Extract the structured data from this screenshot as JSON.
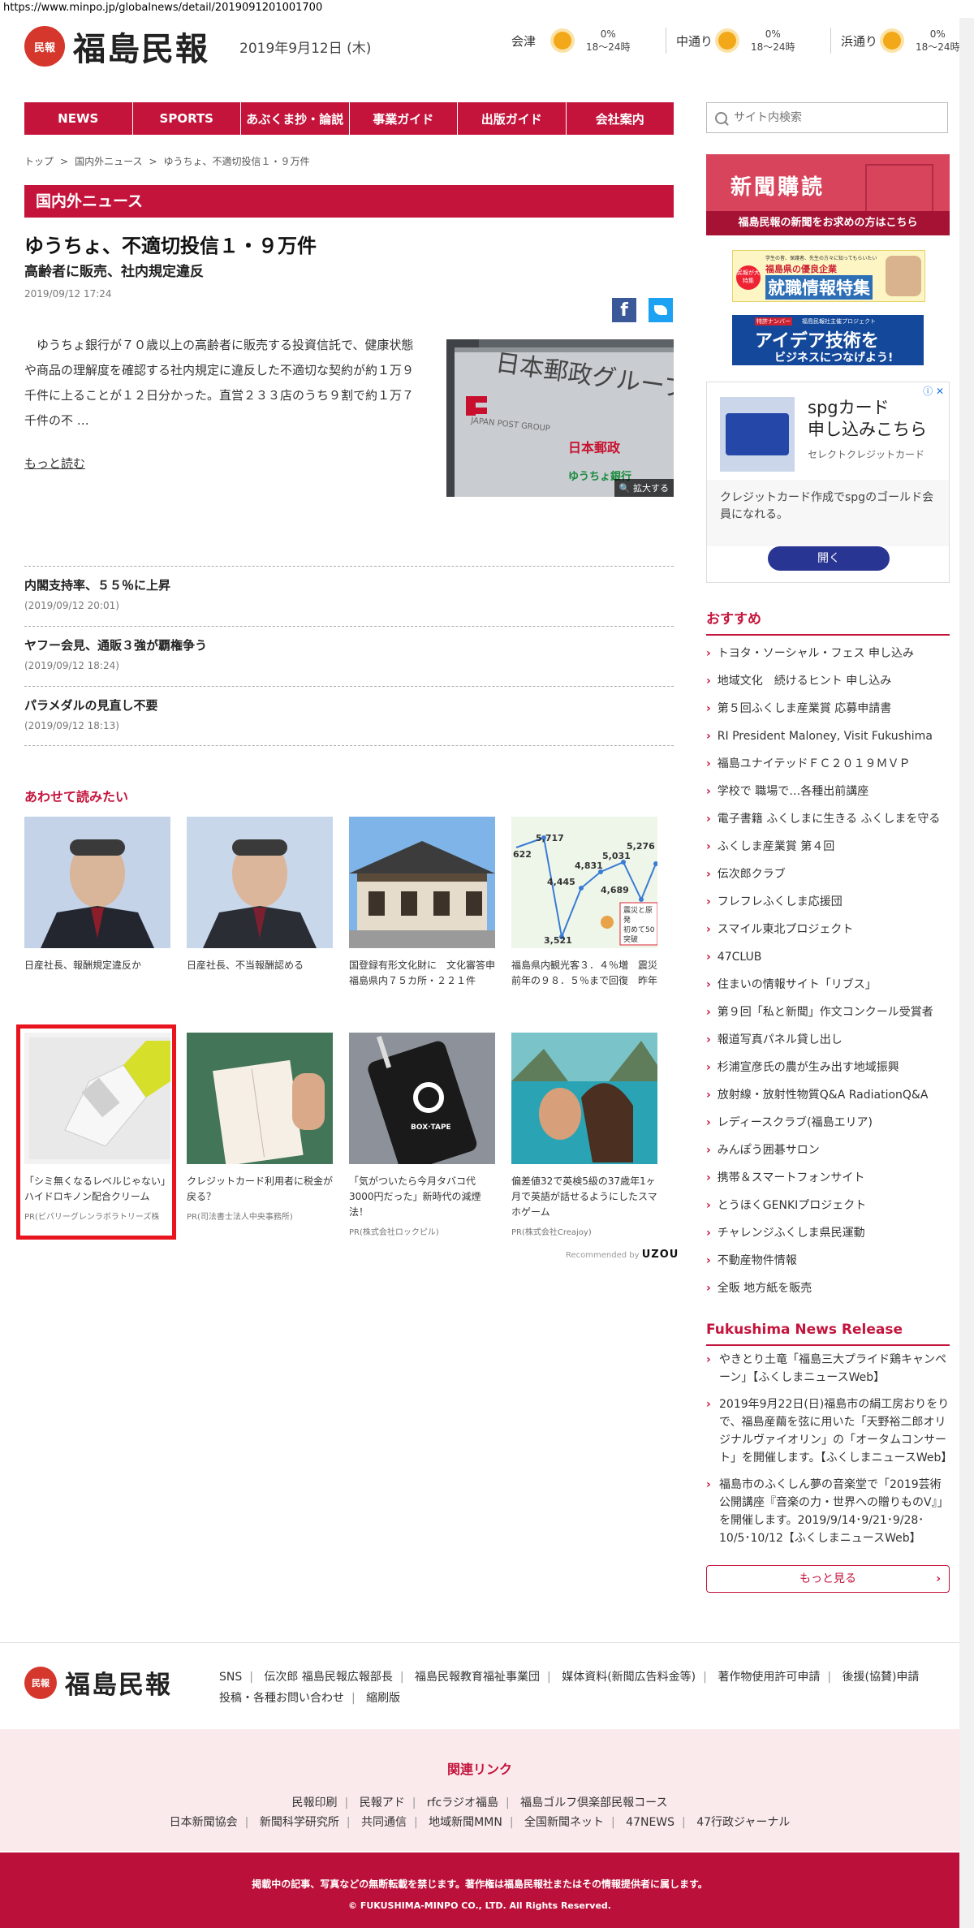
{
  "url": "https://www.minpo.jp/globalnews/detail/2019091201001700",
  "header": {
    "logo_mark": "民報",
    "logo_text": "福島民報",
    "date": "2019年9月12日 (木)",
    "weather": [
      {
        "area": "会津",
        "pct": "0%",
        "time": "18〜24時"
      },
      {
        "area": "中通り",
        "pct": "0%",
        "time": "18〜24時"
      },
      {
        "area": "浜通り",
        "pct": "0%",
        "time": "18〜24時"
      }
    ]
  },
  "nav": [
    "NEWS",
    "SPORTS",
    "あぶくま抄・論説",
    "事業ガイド",
    "出版ガイド",
    "会社案内"
  ],
  "search": {
    "placeholder": "サイト内検索"
  },
  "breadcrumb": [
    "トップ",
    ">",
    "国内外ニュース",
    ">",
    "ゆうちょ、不適切投信１・９万件"
  ],
  "section_title": "国内外ニュース",
  "article": {
    "title": "ゆうちょ、不適切投信１・９万件",
    "subtitle": "高齢者に販売、社内規定違反",
    "date": "2019/09/12 17:24",
    "body": "ゆうちょ銀行が７０歳以上の高齢者に販売する投資信託で、健康状態や商品の理解度を確認する社内規定に違反した不適切な契約が約１万９千件に上ることが１２日分かった。直営２３３店のうち９割で約１万７千件の不 …",
    "more": "もっと読む",
    "photo_text": "日本郵政グループ",
    "photo_sub": "JAPAN POST GROUP",
    "photo_sign1": "日本郵政",
    "photo_sign2": "ゆうちょ銀行",
    "zoom": "拡大する"
  },
  "related_list": [
    {
      "title": "内閣支持率、５５％に上昇",
      "date": "(2019/09/12 20:01)"
    },
    {
      "title": "ヤフー会見、通販３強が覇権争う",
      "date": "(2019/09/12 18:24)"
    },
    {
      "title": "パラメダルの見直し不要",
      "date": "(2019/09/12 18:13)"
    }
  ],
  "recommend": {
    "heading": "あわせて読みたい",
    "cards": [
      {
        "caption": "日産社長、報酬規定違反か",
        "pr": ""
      },
      {
        "caption": "日産社長、不当報酬認める",
        "pr": ""
      },
      {
        "caption": "国登録有形文化財に　文化審答申　福島県内７５カ所・２２１件",
        "pr": ""
      },
      {
        "caption": "福島県内観光客３．４％増　震災前年の９８．５％まで回復　昨年",
        "pr": ""
      },
      {
        "caption": "「シミ無くなるレベルじゃない」ハイドロキノン配合クリーム",
        "pr": "PR(ビバリーグレンラボラトリーズ株"
      },
      {
        "caption": "クレジットカード利用者に税金が戻る？",
        "pr": "PR(司法書士法人中央事務所)"
      },
      {
        "caption": "「気がついたら今月タバコ代3000円だった」新時代の減煙法！",
        "pr": "PR(株式会社ロックピル)"
      },
      {
        "caption": "偏差値32で英検5級の37歳年1ヶ月で英語が話せるようにしたスマホゲーム",
        "pr": "PR(株式会社Creajoy)"
      }
    ],
    "chart_labels": [
      "622",
      "5,717",
      "3,521",
      "4,445",
      "4,831",
      "5,031",
      "4,689",
      "5,276"
    ],
    "chart_note": [
      "震災と原発",
      "初めて50",
      "突破"
    ],
    "box_label": "BOX·TAPE",
    "recommended_by": "Recommended by",
    "recommended_brand": "UZOU"
  },
  "sidebar": {
    "subscribe_title": "新聞購読",
    "subscribe_bar": "福島民報の新聞をお求めの方はこちら",
    "banner1_small": "学生の皆、保護者、先生の方々に知ってもらいたい",
    "banner1_sub": "福島県の優良企業",
    "banner1_main": "就職情報特集",
    "banner1_badge": "民報が大特集",
    "banner2_tag": "特許ナンバー",
    "banner2_sub": "福島民報社主催プロジェクト",
    "banner2_main1": "アイデア技術を",
    "banner2_main2": "ビジネスにつなげよう!",
    "ad": {
      "title": "spgカード\n申し込みこちら",
      "brand": "セレクトクレジットカード",
      "desc": "クレジットカード作成でspgのゴールド会員になれる。",
      "button": "開く",
      "close": "ⓘ ✕"
    },
    "osusume_heading": "おすすめ",
    "osusume": [
      "トヨタ・ソーシャル・フェス 申し込み",
      "地域文化　続けるヒント 申し込み",
      "第５回ふくしま産業賞 応募申請書",
      "RI President Maloney, Visit Fukushima",
      "福島ユナイテッドＦＣ２０１９ＭＶＰ",
      "学校で 職場で…各種出前講座",
      "電子書籍 ふくしまに生きる ふくしまを守る",
      "ふくしま産業賞 第４回",
      "伝次郎クラブ",
      "フレフレふくしま応援団",
      "スマイル東北プロジェクト",
      "47CLUB",
      "住まいの情報サイト「リブス」",
      "第９回「私と新聞」作文コンクール受賞者",
      "報道写真パネル貸し出し",
      "杉浦宣彦氏の農が生み出す地域振興",
      "放射線・放射性物質Q&A RadiationQ&A",
      "レディースクラブ(福島エリア)",
      "みんぽう囲碁サロン",
      "携帯＆スマートフォンサイト",
      "とうほくGENKIプロジェクト",
      "チャレンジふくしま県民運動",
      "不動産物件情報",
      "全販 地方紙を販売"
    ],
    "release_heading": "Fukushima News Release",
    "releases": [
      "やきとり土竜「福島三大プライド鶏キャンペーン」【ふくしまニュースWeb】",
      "2019年9月22日(日)福島市の絹工房おりをりで、福島産繭を弦に用いた「天野裕二郎オリジナルヴァイオリン」の「オータムコンサート」を開催します。【ふくしまニュースWeb】",
      "福島市のふくしん夢の音楽堂で「2019芸術公開講座『音楽の力・世界への贈りものV』」を開催します。2019/9/14･9/21･9/28･10/5･10/12【ふくしまニュースWeb】"
    ],
    "more": "もっと見る"
  },
  "footer": {
    "logo_text": "福島民報",
    "links": [
      "SNS",
      "伝次郎 福島民報広報部長",
      "福島民報教育福祉事業団",
      "媒体資料(新聞広告料金等)",
      "著作物使用許可申請",
      "後援(協賛)申請",
      "投稿・各種お問い合わせ",
      "縮刷版"
    ],
    "related_title": "関連リンク",
    "related_row1": [
      "民報印刷",
      "民報アド",
      "rfcラジオ福島",
      "福島ゴルフ倶楽部民報コース"
    ],
    "related_row2": [
      "日本新聞協会",
      "新聞科学研究所",
      "共同通信",
      "地域新聞MMN",
      "全国新聞ネット",
      "47NEWS",
      "47行政ジャーナル"
    ],
    "copy1": "掲載中の記事、写真などの無断転載を禁じます。著作権は福島民報社またはその情報提供者に属します。",
    "copy2": "© FUKUSHIMA-MINPO CO., LTD. All Rights Reserved."
  },
  "colors": {
    "accent": "#c4143c",
    "link_red": "#e8141e"
  }
}
